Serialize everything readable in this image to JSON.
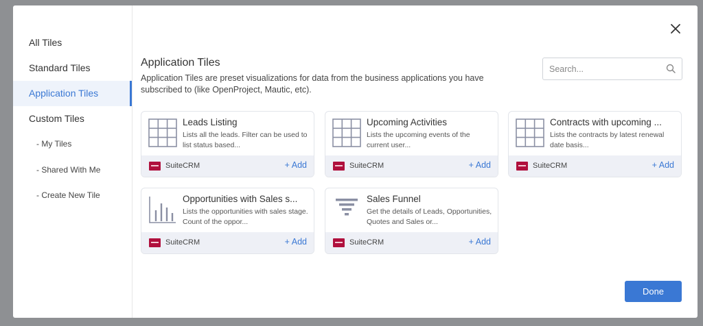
{
  "sidebar": {
    "items": [
      {
        "label": "All Tiles"
      },
      {
        "label": "Standard Tiles"
      },
      {
        "label": "Application Tiles"
      },
      {
        "label": "Custom Tiles"
      },
      {
        "label": "- My Tiles"
      },
      {
        "label": "- Shared With Me"
      },
      {
        "label": "- Create New Tile"
      }
    ],
    "active_index": 2
  },
  "main": {
    "heading": "Application Tiles",
    "description": "Application Tiles are preset visualizations for data from the business applications you have subscribed to (like OpenProject, Mautic, etc).",
    "search_placeholder": "Search...",
    "done_label": "Done"
  },
  "tiles": [
    {
      "title": "Leads Listing",
      "description": "Lists all the leads. Filter can be used to list status based...",
      "provider": "SuiteCRM",
      "add_label": "+ Add",
      "icon": "grid-icon"
    },
    {
      "title": "Upcoming Activities",
      "description": "Lists the upcoming events of the current user...",
      "provider": "SuiteCRM",
      "add_label": "+ Add",
      "icon": "grid-icon"
    },
    {
      "title": "Contracts with upcoming ...",
      "description": "Lists the contracts by latest renewal date basis...",
      "provider": "SuiteCRM",
      "add_label": "+ Add",
      "icon": "grid-icon"
    },
    {
      "title": "Opportunities with Sales s...",
      "description": "Lists the opportunities with sales stage. Count of the oppor...",
      "provider": "SuiteCRM",
      "add_label": "+ Add",
      "icon": "bar-chart-icon"
    },
    {
      "title": "Sales Funnel",
      "description": "Get the details of Leads, Opportunities, Quotes and Sales or...",
      "provider": "SuiteCRM",
      "add_label": "+ Add",
      "icon": "funnel-icon"
    }
  ],
  "colors": {
    "accent": "#3a78d4",
    "suitecrm_logo": "#b0103d"
  }
}
